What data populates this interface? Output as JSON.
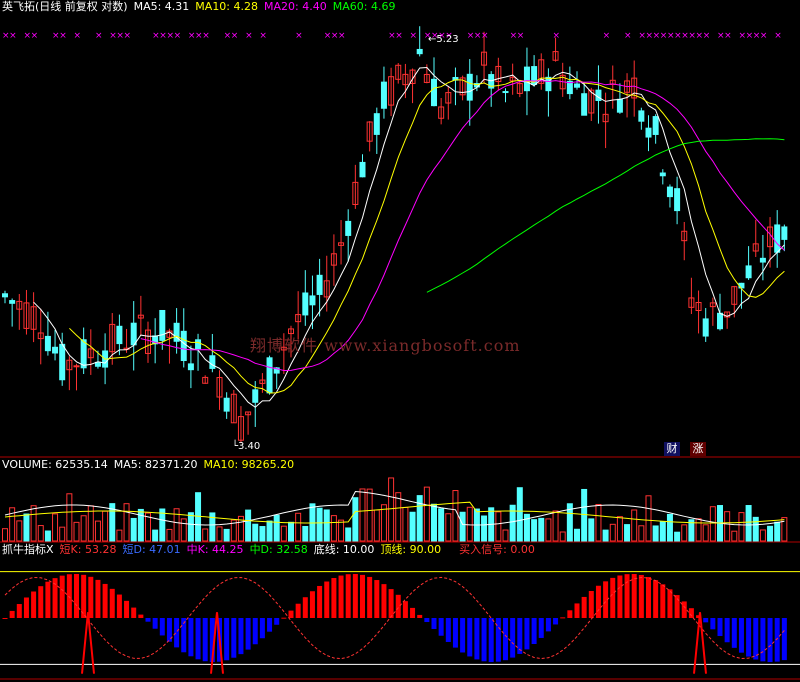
{
  "price_header": {
    "title": "英飞拓(日线 前复权 对数)",
    "ma5": "MA5: 4.31",
    "ma10": "MA10: 4.28",
    "ma20": "MA20: 4.40",
    "ma60": "MA60: 4.69"
  },
  "volume_header": {
    "volume": "VOLUME: 62535.14",
    "ma5": "MA5: 82371.20",
    "ma10": "MA10: 98265.20"
  },
  "indicator_header": {
    "name": "抓牛指标X",
    "short_k": "短K: 53.28",
    "short_d": "短D: 47.01",
    "mid_k": "中K: 44.25",
    "mid_d": "中D: 32.58",
    "bottom": "底线: 10.00",
    "top": "顶线: 90.00",
    "buy": "买入信号: 0.00"
  },
  "watermark": "翔博软件 www.xiangbosoft.com",
  "badges": {
    "cai": "财",
    "zhang": "涨"
  },
  "colors": {
    "up": "#ff3232",
    "down": "#54ffff",
    "ma5": "#ffffff",
    "ma10": "#ffff00",
    "ma20": "#ff00ff",
    "ma60": "#00ff00",
    "blue_bar": "#0000ff",
    "red_bar": "#ff0000",
    "border": "#b00000"
  },
  "chart_data": [
    {
      "type": "candlestick",
      "scale": "log",
      "annotations": [
        {
          "label": "5.23",
          "value": 5.23
        },
        {
          "label": "3.40",
          "value": 3.4
        }
      ],
      "ylim": [
        3.35,
        5.35
      ]
    },
    {
      "type": "bar",
      "name": "VOLUME"
    },
    {
      "type": "bar",
      "name": "抓牛指标X",
      "levels": {
        "bottom": 10.0,
        "top": 90.0
      }
    }
  ]
}
